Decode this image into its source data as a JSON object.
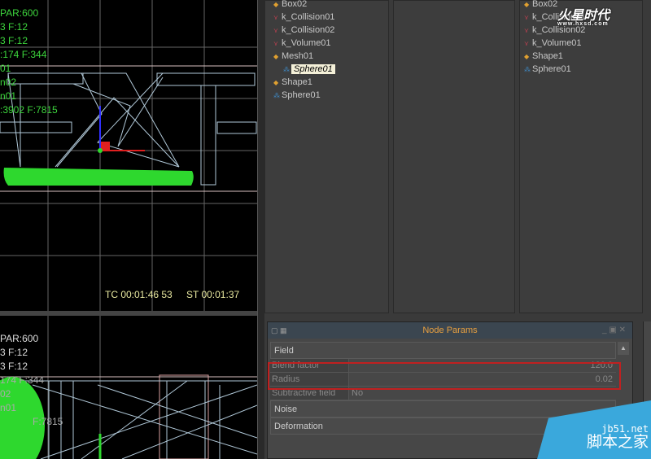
{
  "viewport_top": {
    "stats": [
      "PAR:600",
      "3 F:12",
      "3 F:12",
      ":174 F:344",
      "01",
      "n02",
      "n01",
      ":3902 F:7815"
    ],
    "timecode": "TC 00:01:46 53",
    "systime": "ST 00:01:37"
  },
  "viewport_bottom": {
    "stats": [
      "PAR:600",
      "3 F:12",
      "3 F:12",
      "174 F:344",
      "02",
      "n01",
      "F:7815"
    ]
  },
  "tree_left": [
    {
      "label": "Box02",
      "icon": "box-icon",
      "color": "#e0a030"
    },
    {
      "label": "k_Collision01",
      "icon": "kfield-icon",
      "color": "#c04050"
    },
    {
      "label": "k_Collision02",
      "icon": "kfield-icon",
      "color": "#c04050"
    },
    {
      "label": "k_Volume01",
      "icon": "kfield-icon",
      "color": "#c04050"
    },
    {
      "label": "Mesh01",
      "icon": "box-icon",
      "color": "#e0a030"
    },
    {
      "label": "Sphere01",
      "icon": "sphere-icon",
      "color": "#4090d0",
      "selected": true
    },
    {
      "label": "Shape1",
      "icon": "box-icon",
      "color": "#e0a030"
    },
    {
      "label": "Sphere01",
      "icon": "sphere-icon",
      "color": "#4090d0"
    }
  ],
  "tree_right": [
    {
      "label": "Box02",
      "icon": "box-icon",
      "color": "#e0a030"
    },
    {
      "label": "k_Collision01",
      "icon": "kfield-icon",
      "color": "#c04050"
    },
    {
      "label": "k_Collision02",
      "icon": "kfield-icon",
      "color": "#c04050"
    },
    {
      "label": "k_Volume01",
      "icon": "kfield-icon",
      "color": "#c04050"
    },
    {
      "label": "Shape1",
      "icon": "box-icon",
      "color": "#e0a030"
    },
    {
      "label": "Sphere01",
      "icon": "sphere-icon",
      "color": "#4090d0"
    }
  ],
  "node_params": {
    "title": "Node Params",
    "groups": {
      "field": "Field",
      "noise": "Noise",
      "deformation": "Deformation"
    },
    "rows": [
      {
        "label": "Blend factor",
        "value": "120.0"
      },
      {
        "label": "Radius",
        "value": "0.02"
      },
      {
        "label": "Subtractive field",
        "value": "No"
      }
    ]
  },
  "watermarks": {
    "hxsd": "火星时代",
    "hxsd_url": "www.hxsd.com",
    "jb51": "jb51.net",
    "jb51_cn": "脚本之家"
  },
  "colors": {
    "highlight": "#c02020",
    "title": "#e8a040"
  }
}
